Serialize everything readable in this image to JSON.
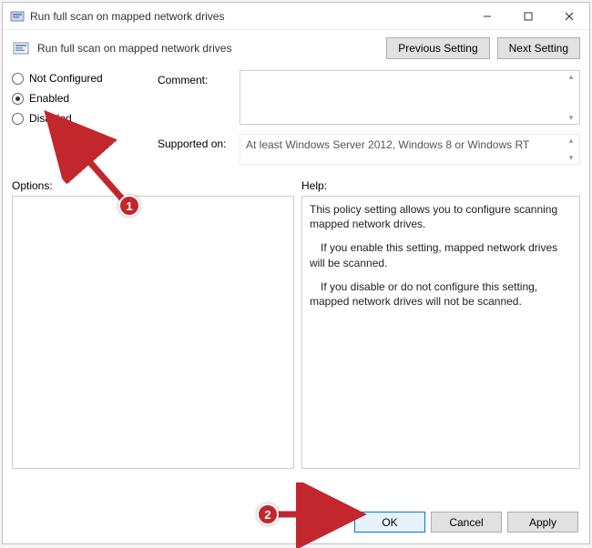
{
  "window": {
    "title": "Run full scan on mapped network drives",
    "controls": {
      "min_icon": "minimize-icon",
      "max_icon": "maximize-icon",
      "close_icon": "close-icon"
    }
  },
  "header": {
    "setting_title": "Run full scan on mapped network drives",
    "prev_label": "Previous Setting",
    "next_label": "Next Setting"
  },
  "state": {
    "options": [
      {
        "label": "Not Configured",
        "checked": false
      },
      {
        "label": "Enabled",
        "checked": true
      },
      {
        "label": "Disabled",
        "checked": false
      }
    ]
  },
  "meta": {
    "comment_label": "Comment:",
    "comment_value": "",
    "supported_label": "Supported on:",
    "supported_value": "At least Windows Server 2012, Windows 8 or Windows RT"
  },
  "sections": {
    "options_label": "Options:",
    "help_label": "Help:"
  },
  "help": {
    "p1": "This policy setting allows you to configure scanning mapped network drives.",
    "p2": "If you enable this setting, mapped network drives will be scanned.",
    "p3": "If you disable or do not configure this setting, mapped network drives will not be scanned."
  },
  "footer": {
    "ok": "OK",
    "cancel": "Cancel",
    "apply": "Apply"
  },
  "annotations": {
    "badge1": "1",
    "badge2": "2"
  }
}
